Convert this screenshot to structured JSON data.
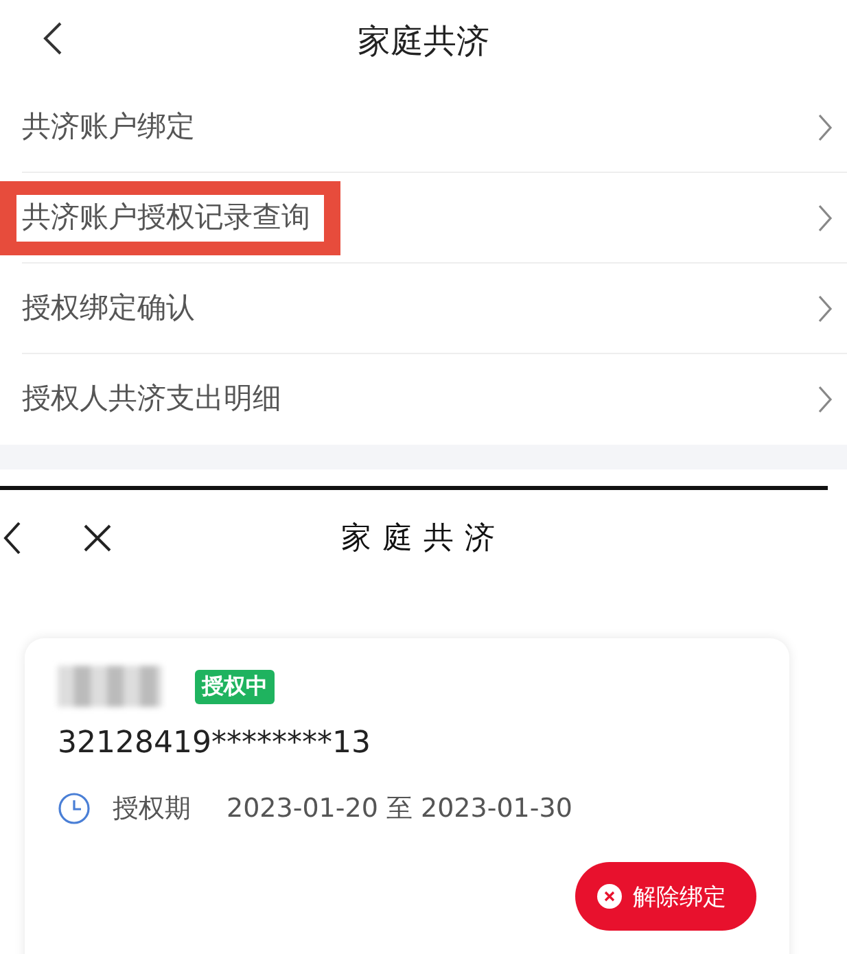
{
  "top_screen": {
    "title": "家庭共济",
    "menu_items": [
      {
        "label": "共济账户绑定",
        "highlighted": false
      },
      {
        "label": "共济账户授权记录查询",
        "highlighted": true
      },
      {
        "label": "授权绑定确认",
        "highlighted": false
      },
      {
        "label": "授权人共济支出明细",
        "highlighted": false
      }
    ]
  },
  "bottom_screen": {
    "title": "家庭共济",
    "card": {
      "name_blurred": true,
      "status": "授权中",
      "id_number": "32128419********13",
      "period_label": "授权期",
      "period_value": "2023-01-20 至 2023-01-30",
      "unbind_button": "解除绑定"
    }
  }
}
